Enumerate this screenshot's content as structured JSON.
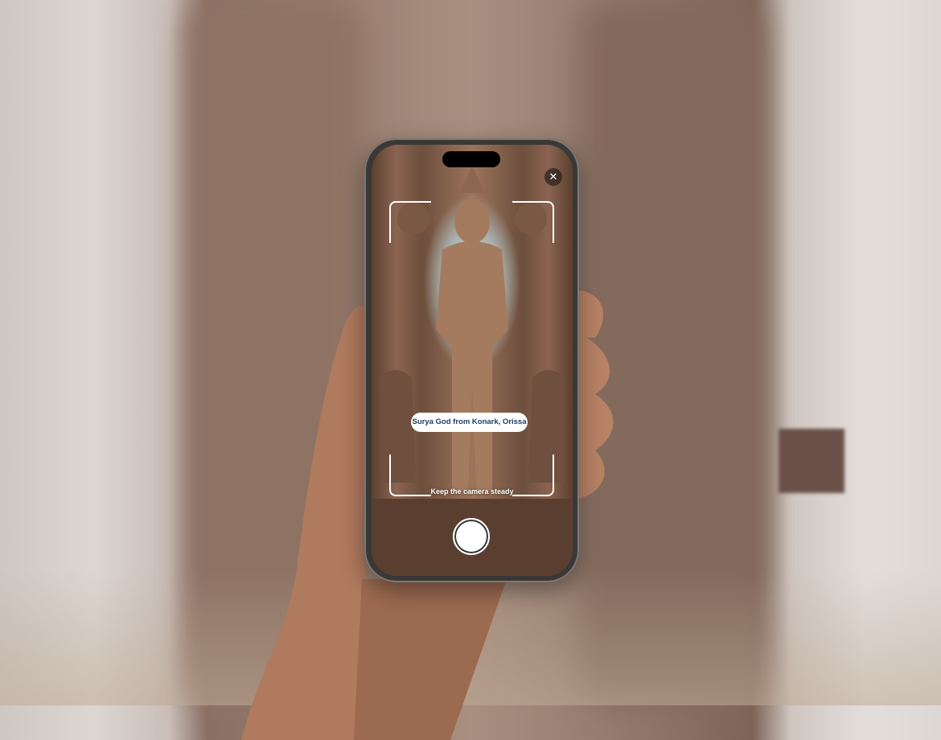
{
  "app": {
    "close_icon": "close-icon",
    "recognized_label": "Surya God from Konark, Orissa",
    "instruction": "Keep the camera steady",
    "shutter_icon": "shutter-button-circle"
  },
  "colors": {
    "label_text": "#1c3f63",
    "label_bg": "#ffffff",
    "viewfinder": "#ffffff"
  }
}
